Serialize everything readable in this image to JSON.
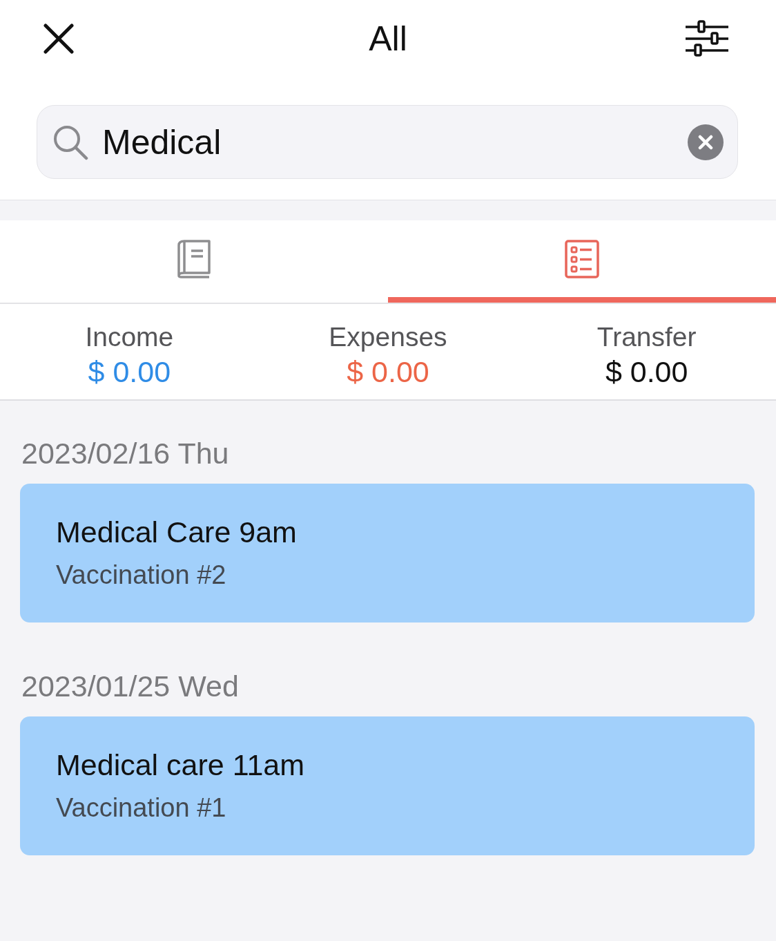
{
  "header": {
    "title": "All"
  },
  "search": {
    "value": "Medical"
  },
  "tabs": [
    {
      "kind": "book",
      "selected": false
    },
    {
      "kind": "list",
      "selected": true
    }
  ],
  "summary": [
    {
      "label": "Income",
      "value": "$ 0.00",
      "color": "#2f8ce6"
    },
    {
      "label": "Expenses",
      "value": "$ 0.00",
      "color": "#ec6547"
    },
    {
      "label": "Transfer",
      "value": "$ 0.00",
      "color": "#111111"
    }
  ],
  "groups": [
    {
      "date": "2023/02/16 Thu",
      "entries": [
        {
          "title": "Medical Care 9am",
          "note": "Vaccination #2"
        }
      ]
    },
    {
      "date": "2023/01/25 Wed",
      "entries": [
        {
          "title": "Medical care 11am",
          "note": "Vaccination #1"
        }
      ]
    }
  ]
}
